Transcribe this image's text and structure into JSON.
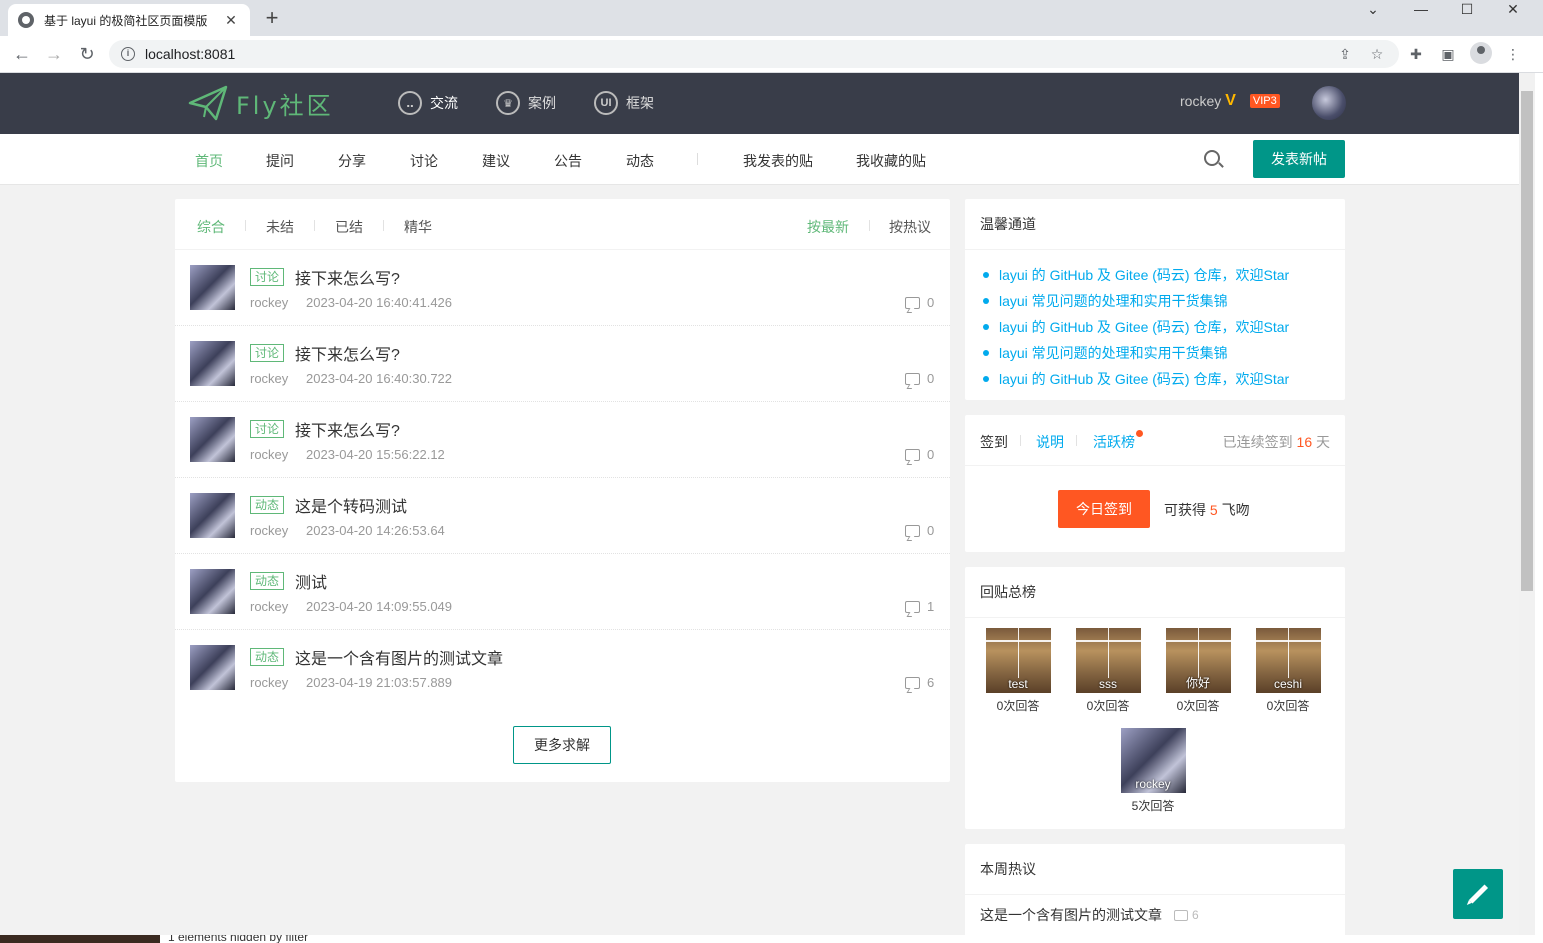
{
  "browser": {
    "tab_title": "基于 layui 的极简社区页面模版",
    "tab_close": "✕",
    "new_tab": "+",
    "url": "localhost:8081",
    "win_min": "⌄",
    "win_minimize": "—",
    "win_max": "☐",
    "win_close": "✕"
  },
  "header": {
    "logo_text": "Fly社区",
    "nav": [
      {
        "label": "交流",
        "icon": "chat-icon"
      },
      {
        "label": "案例",
        "icon": "crown-icon"
      },
      {
        "label": "框架",
        "icon": "ui-icon"
      }
    ],
    "username": "rockey",
    "v_mark": "V",
    "vip": "VIP3"
  },
  "subnav": {
    "items": [
      "首页",
      "提问",
      "分享",
      "讨论",
      "建议",
      "公告",
      "动态"
    ],
    "my_posts": "我发表的贴",
    "my_favorites": "我收藏的贴",
    "post_button": "发表新帖"
  },
  "filters": {
    "tabs": [
      "综合",
      "未结",
      "已结",
      "精华"
    ],
    "sort_new": "按最新",
    "sort_hot": "按热议"
  },
  "posts": [
    {
      "tag": "讨论",
      "title": "接下来怎么写?",
      "author": "rockey",
      "time": "2023-04-20 16:40:41.426",
      "comments": "0"
    },
    {
      "tag": "讨论",
      "title": "接下来怎么写?",
      "author": "rockey",
      "time": "2023-04-20 16:40:30.722",
      "comments": "0"
    },
    {
      "tag": "讨论",
      "title": "接下来怎么写?",
      "author": "rockey",
      "time": "2023-04-20 15:56:22.12",
      "comments": "0"
    },
    {
      "tag": "动态",
      "title": "这是个转码测试",
      "author": "rockey",
      "time": "2023-04-20 14:26:53.64",
      "comments": "0"
    },
    {
      "tag": "动态",
      "title": "测试",
      "author": "rockey",
      "time": "2023-04-20 14:09:55.049",
      "comments": "1"
    },
    {
      "tag": "动态",
      "title": "这是一个含有图片的测试文章",
      "author": "rockey",
      "time": "2023-04-19 21:03:57.889",
      "comments": "6"
    }
  ],
  "more_button": "更多求解",
  "tips": {
    "title": "温馨通道",
    "links": [
      "layui 的 GitHub 及 Gitee (码云) 仓库，欢迎Star",
      "layui 常见问题的处理和实用干货集锦",
      "layui 的 GitHub 及 Gitee (码云) 仓库，欢迎Star",
      "layui 常见问题的处理和实用干货集锦",
      "layui 的 GitHub 及 Gitee (码云) 仓库，欢迎Star"
    ]
  },
  "sign": {
    "tab_sign": "签到",
    "tab_desc": "说明",
    "tab_active": "活跃榜",
    "streak_prefix": "已连续签到",
    "streak_days": "16",
    "streak_suffix": "天",
    "button": "今日签到",
    "earn_prefix": "可获得",
    "earn_amount": "5",
    "earn_suffix": "飞吻"
  },
  "rank": {
    "title": "回贴总榜",
    "users": [
      {
        "name": "test",
        "count": "0次回答"
      },
      {
        "name": "sss",
        "count": "0次回答"
      },
      {
        "name": "你好",
        "count": "0次回答"
      },
      {
        "name": "ceshi",
        "count": "0次回答"
      },
      {
        "name": "rockey",
        "count": "5次回答"
      }
    ]
  },
  "hot": {
    "title": "本周热议",
    "items": [
      {
        "title": "这是一个含有图片的测试文章",
        "count": "6"
      }
    ]
  },
  "status": {
    "text": "1 elements hidden by filter"
  }
}
